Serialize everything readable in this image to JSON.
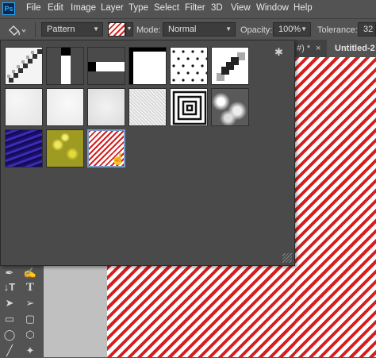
{
  "app": {
    "logo_text": "Ps"
  },
  "menu": [
    "File",
    "Edit",
    "Image",
    "Layer",
    "Type",
    "Select",
    "Filter",
    "3D",
    "View",
    "Window",
    "Help"
  ],
  "options": {
    "tool_icon": "paint-bucket-icon",
    "fill_source": "Pattern",
    "mode_label": "Mode:",
    "mode_value": "Normal",
    "opacity_label": "Opacity:",
    "opacity_value": "100%",
    "tolerance_label": "Tolerance:",
    "tolerance_value": "32"
  },
  "tabs": [
    {
      "label": "#) *",
      "close": "×"
    },
    {
      "label": "Untitled-2"
    }
  ],
  "picker": {
    "gear_icon": "gear-icon",
    "patterns": [
      {
        "name": "diagonal-stripe-pattern",
        "selected": false
      },
      {
        "name": "vertical-bar-pattern",
        "selected": false
      },
      {
        "name": "horizontal-bar-pattern",
        "selected": false
      },
      {
        "name": "corner-frame-pattern",
        "selected": false
      },
      {
        "name": "dots-pattern",
        "selected": false
      },
      {
        "name": "diagonal-blocks-pattern",
        "selected": false
      },
      {
        "name": "light-noise-pattern",
        "selected": false
      },
      {
        "name": "fine-noise-pattern",
        "selected": false
      },
      {
        "name": "soft-noise-pattern",
        "selected": false
      },
      {
        "name": "grain-pattern",
        "selected": false
      },
      {
        "name": "concentric-squares-pattern",
        "selected": false
      },
      {
        "name": "clouds-pattern",
        "selected": false
      },
      {
        "name": "blue-texture-pattern",
        "selected": false
      },
      {
        "name": "yellow-texture-pattern",
        "selected": false
      },
      {
        "name": "red-stripes-pattern",
        "selected": true
      }
    ]
  },
  "colors": {
    "accent": "#31a8ff",
    "stripe_red": "#d61e1e",
    "panel": "#4a4a4a",
    "ui": "#535353"
  }
}
